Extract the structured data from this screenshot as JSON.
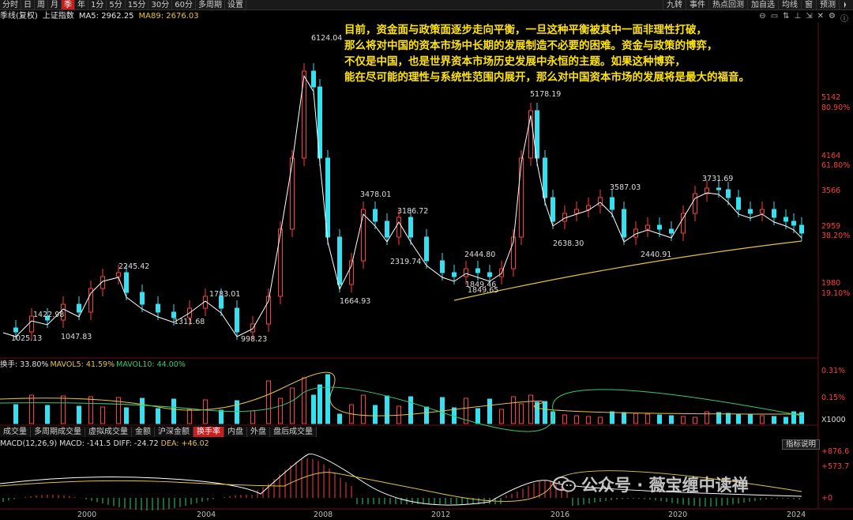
{
  "toolbar": {
    "tabs": [
      "分时",
      "日",
      "周",
      "月",
      "季",
      "年",
      "1分",
      "5分",
      "15分",
      "30分",
      "60分",
      "多周期",
      "设置"
    ],
    "active_tab": "季",
    "right_tabs": [
      "九转",
      "事件",
      "热点回测",
      "加自选",
      "均线",
      "窗",
      "预测"
    ]
  },
  "title": {
    "period": "季线(复权)",
    "index_name": "上证指数",
    "ma5": "MA5: 2962.25",
    "ma89": "MA89: 2676.03"
  },
  "annotation": [
    "目前，资金面与政策面逐步走向平衡，一旦这种平衡被其中一面非理性打破，",
    "那么将对中国的资本市场中长期的发展制造不必要的困难。资金与政策的博弈，",
    "不仅是中国，也是世界资本市场历史发展中永恒的主题。如果这种博弈，",
    "能在尽可能的理性与系统性范围内展开，那么对中国资本市场的发展将是最大的福音。"
  ],
  "price_axis": {
    "labels": [
      "5142",
      "80.90%",
      "4164",
      "61.80%",
      "3566",
      "2959",
      "38.20%",
      "1980",
      "19.10%"
    ]
  },
  "price_annotations": [
    "6124.04",
    "5178.19",
    "3731.69",
    "3587.03",
    "3478.01",
    "3186.72",
    "2638.30",
    "2440.91",
    "2444.80",
    "2319.74",
    "1849.46",
    "1849.65",
    "2245.42",
    "1783.01",
    "1664.93",
    "1422.98",
    "1311.68",
    "1047.83",
    "1025.13",
    "998.23"
  ],
  "volume": {
    "title_main": "换手: 33.80%",
    "title_mavol5": "MAVOL5: 41.59%",
    "title_mavol10": "MAVOL10: 44.00%",
    "axis_labels": [
      "0.31%",
      "0.15%",
      "X1000"
    ]
  },
  "subtabs": {
    "items": [
      "成交量",
      "多周期成交量",
      "虚拟成交量",
      "金额",
      "沪深金额",
      "换手率",
      "内盘",
      "外盘",
      "盘后成交量"
    ],
    "active": "换手率"
  },
  "macd": {
    "title": "MACD(12,26,9)",
    "macd_value": "MACD: -141.5",
    "diff_value": "DIFF: -24.72",
    "dea_value": "DEA: +46.02",
    "axis_labels": [
      "+876.6",
      "+573.7",
      "+0"
    ],
    "indicator_button": "指标说明"
  },
  "watermark": "公众号 · 薇宝缠中读禅",
  "x_axis": [
    "2000",
    "2004",
    "2008",
    "2012",
    "2016",
    "2020",
    "2024"
  ],
  "colors": {
    "up": "#ff3b3b",
    "down": "#35e0f0",
    "ma5": "#ffffff",
    "ma89": "#e8c33a",
    "annotation": "#ffe400",
    "active_tab": "#c81e1e"
  }
}
